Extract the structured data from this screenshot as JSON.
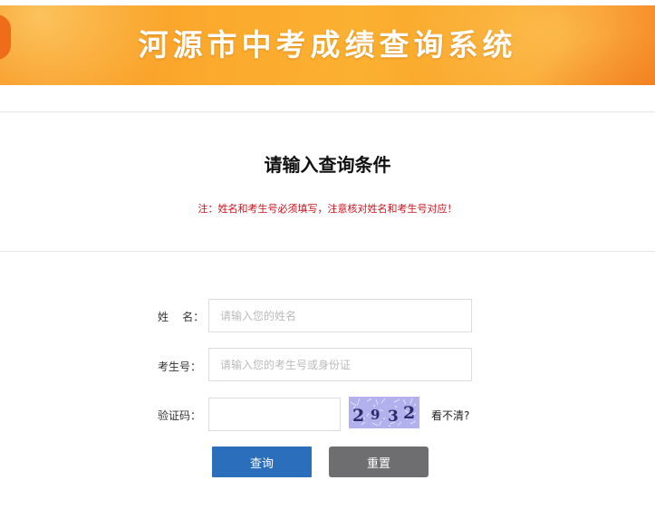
{
  "banner": {
    "title": "河源市中考成绩查询系统"
  },
  "section": {
    "heading": "请输入查询条件",
    "notice": "注：姓名和考生号必须填写，注意核对姓名和考生号对应！"
  },
  "form": {
    "name": {
      "label": "姓    名：",
      "placeholder": "请输入您的姓名",
      "value": ""
    },
    "exam_id": {
      "label": "考生号：",
      "placeholder": "请输入您的考生号或身份证",
      "value": ""
    },
    "captcha": {
      "label": "验证码：",
      "value": "",
      "image_digits": [
        "2",
        "9",
        "3",
        "2"
      ],
      "refresh_label": "看不清?"
    },
    "buttons": {
      "query_label": "查询",
      "reset_label": "重置"
    }
  },
  "colors": {
    "banner_orange": "#f9a128",
    "notice_red": "#d0121b",
    "query_blue": "#2a6ebc",
    "reset_gray": "#6e6e70"
  }
}
